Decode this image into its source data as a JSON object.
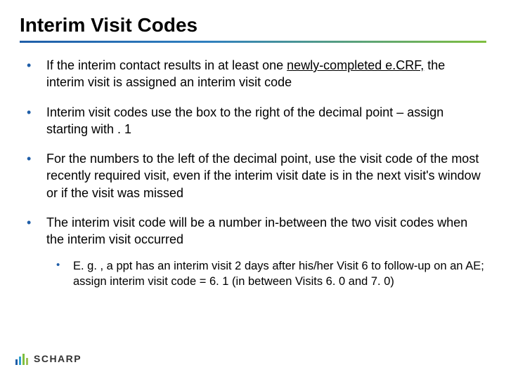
{
  "slide": {
    "title": "Interim Visit Codes",
    "bullets": [
      {
        "pre": "If the interim contact results in at least one ",
        "u": "newly-completed e.CRF,",
        "post": " the interim visit is assigned an interim visit code"
      },
      {
        "text": "Interim visit codes use the box to the right of the decimal point – assign starting with . 1"
      },
      {
        "text": "For the numbers to the left of the decimal point, use the visit code of the most recently required visit, even if the interim visit date is in the next visit's window or if the visit was missed"
      },
      {
        "text": "The interim visit code will be a number in-between the two visit codes when the interim visit occurred",
        "sub": [
          "E. g. , a ppt has an interim visit 2 days after his/her Visit 6 to follow-up on an AE; assign interim visit code = 6. 1 (in between Visits 6. 0 and 7. 0)"
        ]
      }
    ],
    "logo_text": "SCHARP"
  }
}
